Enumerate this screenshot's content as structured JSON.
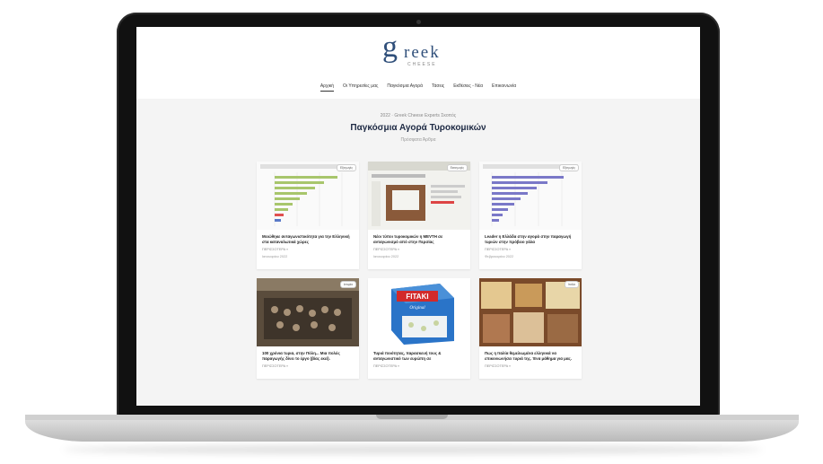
{
  "site": {
    "logo_letter": "g",
    "logo_text": "reek",
    "logo_sub": "CHEESE"
  },
  "nav": [
    {
      "label": "Αρχική",
      "active": true
    },
    {
      "label": "Οι Υπηρεσίες μας",
      "active": false
    },
    {
      "label": "Παγκόσμια Αγορά",
      "active": false
    },
    {
      "label": "Τάσεις",
      "active": false
    },
    {
      "label": "Εκθέσεις - Νέα",
      "active": false
    },
    {
      "label": "Επικοινωνία",
      "active": false
    }
  ],
  "intro": {
    "meta": "2022 · Greek Cheese Experts Σκοπός",
    "title": "Παγκόσμια Αγορά Τυροκομικών",
    "breadcrumb": "Πρόσφατα Άρθρα"
  },
  "cards": [
    {
      "title": "Μειώθηκε ανταγωνιστικότητα για την Ελληνική στα καταναλωτικά χώρες",
      "more": "ΠΕΡΙΣΣΟΤΕΡΑ »",
      "date": "Ιανουαρίου 2022",
      "thumb": "green-bar-chart"
    },
    {
      "title": "Νέοι τύποι τυροκομικών η MEVΤΗ σε ανταγωνισμό από στην Περσίας",
      "more": "ΠΕΡΙΣΣΟΤΕΡΑ »",
      "date": "Ιανουαρίου 2022",
      "thumb": "web-screenshot-cheese"
    },
    {
      "title": "Leader η Ελλάδα στην αγορά στην παραγωγή τυριών στην πρόβειο γάλα",
      "more": "ΠΕΡΙΣΣΟΤΕΡΑ »",
      "date": "Φεβρουαρίου 2022",
      "thumb": "purple-bar-chart"
    },
    {
      "title": "100 χρόνια τυρια, στην Πόλη... Μια πολύς παραγωγής δίνει το έργο (βίας εκεί).",
      "more": "ΠΕΡΙΣΣΟΤΕΡΑ »",
      "date": "",
      "thumb": "historic-photo"
    },
    {
      "title": "Τυριά ποιότητας, παρασκευή τους & ανταγωνιστικό των ευρώπη σε",
      "more": "ΠΕΡΙΣΣΟΤΕΡΑ »",
      "date": "",
      "thumb": "fitaki-package"
    },
    {
      "title": "Πως η Ιταλία θεμελιωμένα ελληνικά να επικοινωνήσει τυριά της. Ένα μάθημα για μας.",
      "more": "ΠΕΡΙΣΣΟΤΕΡΑ »",
      "date": "",
      "thumb": "cheese-wheels"
    }
  ],
  "thumb_text": {
    "badge1": "Εξαγωγές",
    "badge2": "Εισαγωγές",
    "badge3": "Εξαγωγές",
    "badge4": "Ιστορία",
    "badge6": "Ιταλία",
    "fitaki": "FITAKI",
    "fitaki_sub": "Original",
    "web_label": "Feta - Persian Cheese"
  },
  "colors": {
    "brand": "#2f4f7a",
    "title": "#1e2a44",
    "chart_green": "#a8c66c",
    "chart_purple": "#7a78c8",
    "fitaki_red": "#d22a2a",
    "fitaki_blue": "#2a74c8"
  }
}
